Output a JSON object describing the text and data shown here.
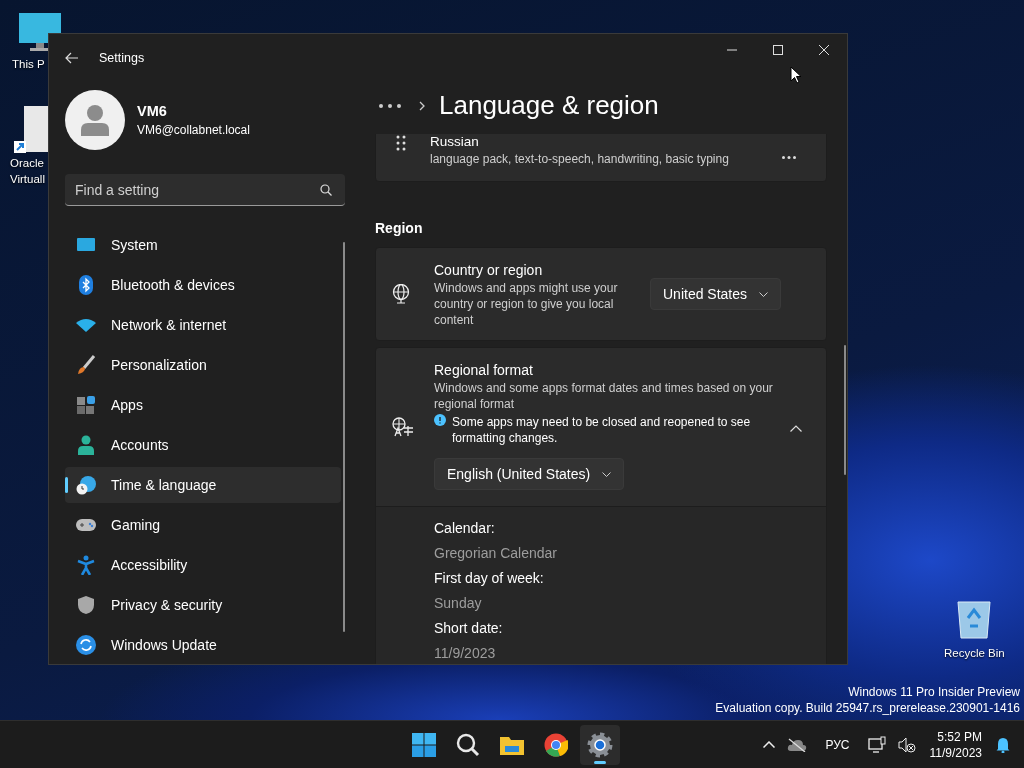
{
  "desktop_icons": [
    {
      "kind": "monitor",
      "lines": [
        "This P"
      ]
    },
    {
      "kind": "document",
      "lines": [
        "Oracle",
        "Virtuall"
      ]
    },
    {
      "kind": "recycle",
      "lines": [
        "Recycle Bin"
      ]
    }
  ],
  "window": {
    "title": "Settings"
  },
  "profile": {
    "name": "VM6",
    "email": "VM6@collabnet.local"
  },
  "search": {
    "placeholder": "Find a setting"
  },
  "nav": [
    {
      "label": "System",
      "selected": false
    },
    {
      "label": "Bluetooth & devices",
      "selected": false
    },
    {
      "label": "Network & internet",
      "selected": false
    },
    {
      "label": "Personalization",
      "selected": false
    },
    {
      "label": "Apps",
      "selected": false
    },
    {
      "label": "Accounts",
      "selected": false
    },
    {
      "label": "Time & language",
      "selected": true
    },
    {
      "label": "Gaming",
      "selected": false
    },
    {
      "label": "Accessibility",
      "selected": false
    },
    {
      "label": "Privacy & security",
      "selected": false
    },
    {
      "label": "Windows Update",
      "selected": false
    }
  ],
  "page_title": "Language & region",
  "language": {
    "name": "Russian",
    "features": "language pack, text-to-speech, handwriting, basic typing"
  },
  "section_heading": "Region",
  "settings": [
    {
      "kind": "dropdown",
      "title": "Country or region",
      "description": "Windows and apps might use your country or region to give you local content",
      "value": "United States"
    },
    {
      "kind": "expander",
      "title": "Regional format",
      "description": "Windows and some apps format dates and times based on your regional format",
      "note": "Some apps may need to be closed and reopened to see formatting changes.",
      "value": "English (United States)",
      "expanded": true,
      "details": [
        {
          "label": "Calendar:",
          "value": "Gregorian Calendar"
        },
        {
          "label": "First day of week:",
          "value": "Sunday"
        },
        {
          "label": "Short date:",
          "value": "11/9/2023"
        }
      ]
    }
  ],
  "build_info": [
    "Windows 11 Pro Insider Preview",
    "Evaluation copy. Build 25947.rs_prerelease.230901-1416"
  ],
  "taskbar": {
    "apps": [
      {
        "kind": "start",
        "selected": false
      },
      {
        "kind": "search",
        "selected": false
      },
      {
        "kind": "explorer",
        "selected": false
      },
      {
        "kind": "browser",
        "selected": false
      },
      {
        "kind": "settings",
        "selected": true
      }
    ],
    "language": "РУС",
    "time": "5:52 PM",
    "date": "11/9/2023"
  }
}
